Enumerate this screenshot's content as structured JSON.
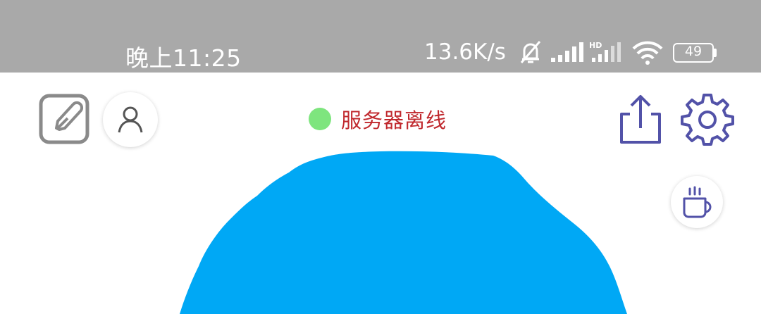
{
  "status_bar": {
    "time": "晚上11:25",
    "net_speed": "13.6K/s",
    "battery_level": "49",
    "icons": [
      "bell-muted-icon",
      "signal-icon",
      "hd-signal-icon",
      "wifi-icon",
      "battery-icon"
    ]
  },
  "toolbar": {
    "server_status": "服务器离线",
    "status_dot_color": "#7ee57e",
    "status_text_color": "#c0282d",
    "accent_color": "#5252a8",
    "icons": [
      "edit-note-icon",
      "user-icon",
      "share-icon",
      "settings-gear-icon",
      "coffee-cup-icon"
    ]
  },
  "canvas": {
    "shape_color": "#00a8f5"
  }
}
